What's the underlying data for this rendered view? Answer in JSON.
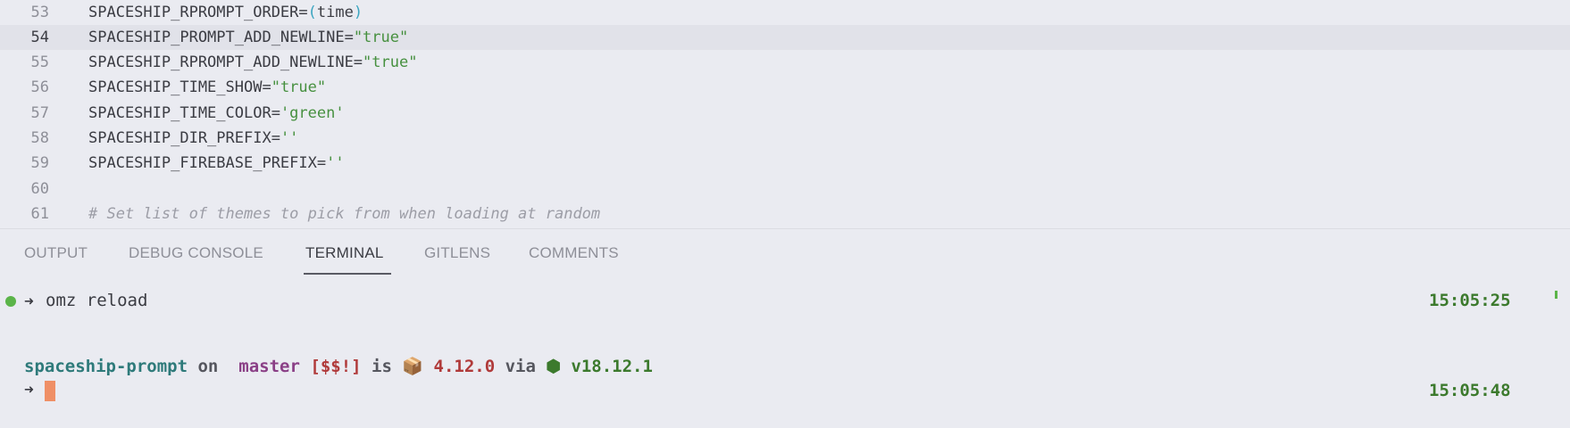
{
  "editor": {
    "lines": [
      {
        "num": "53",
        "key": "SPACESHIP_RPROMPT_ORDER=",
        "open": "(",
        "val": "time",
        "close": ")"
      },
      {
        "num": "54",
        "key": "SPACESHIP_PROMPT_ADD_NEWLINE=",
        "str": "\"true\""
      },
      {
        "num": "55",
        "key": "SPACESHIP_RPROMPT_ADD_NEWLINE=",
        "str": "\"true\""
      },
      {
        "num": "56",
        "key": "SPACESHIP_TIME_SHOW=",
        "str": "\"true\""
      },
      {
        "num": "57",
        "key": "SPACESHIP_TIME_COLOR=",
        "str": "'green'"
      },
      {
        "num": "58",
        "key": "SPACESHIP_DIR_PREFIX=",
        "str": "''"
      },
      {
        "num": "59",
        "key": "SPACESHIP_FIREBASE_PREFIX=",
        "str": "''"
      },
      {
        "num": "60"
      },
      {
        "num": "61",
        "comment": "# Set list of themes to pick from when loading at random"
      }
    ]
  },
  "panel": {
    "tabs": [
      "OUTPUT",
      "DEBUG CONSOLE",
      "TERMINAL",
      "GITLENS",
      "COMMENTS"
    ],
    "active_tab": "TERMINAL"
  },
  "terminal": {
    "arrow": "➜",
    "command": "omz reload",
    "time1": "15:05:25",
    "prompt": {
      "dir": "spaceship-prompt",
      "on": "on",
      "branch_icon": "",
      "branch": "master",
      "git_status": "[$$!]",
      "is": "is",
      "package_icon": "📦",
      "package_version": "4.12.0",
      "via": "via",
      "node_icon": "⬢",
      "node_version": "v18.12.1"
    },
    "time2": "15:05:48"
  },
  "colors": {
    "background": "#eaebf1",
    "string": "#46903f",
    "time": "#3c7a2d",
    "cursor": "#ef8f66"
  }
}
